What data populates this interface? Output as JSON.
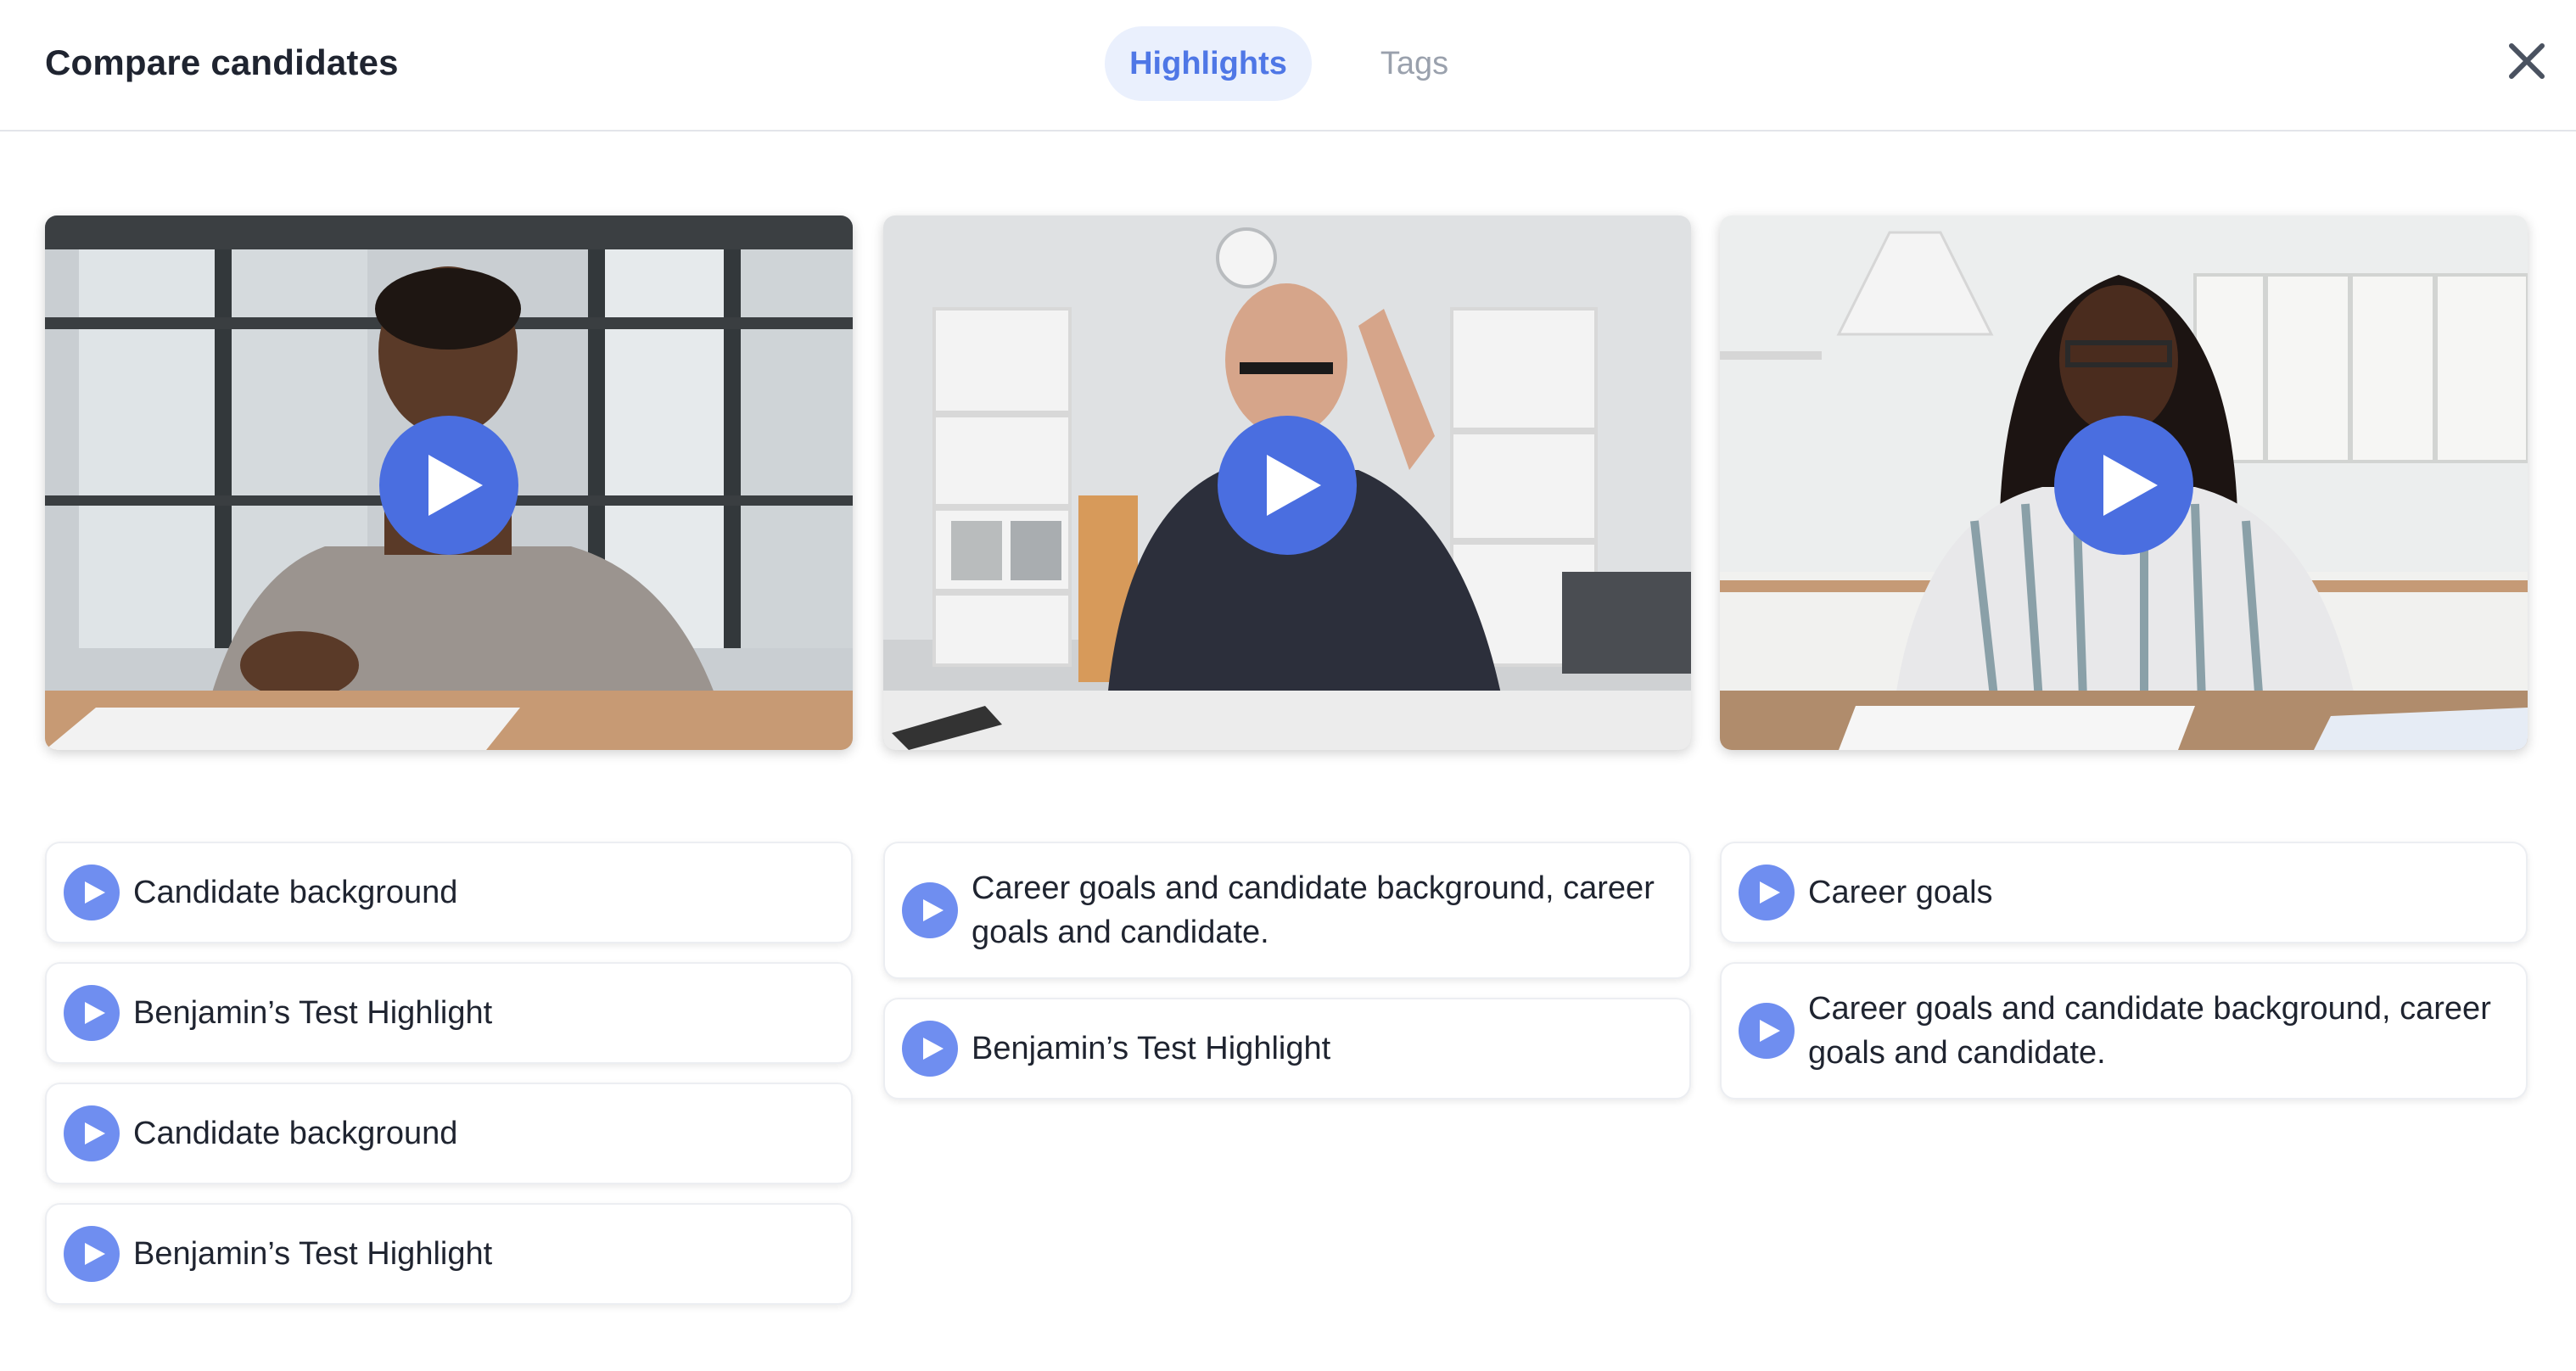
{
  "header": {
    "title": "Compare candidates",
    "tabs": [
      {
        "label": "Highlights",
        "active": true
      },
      {
        "label": "Tags",
        "active": false
      }
    ],
    "close_icon": "close-icon"
  },
  "colors": {
    "accent": "#4f77e6",
    "active_tab_bg": "#eaf0fd",
    "inactive_tab": "#9aa1ad",
    "play_button": "#4a6ee0",
    "chip_play": "#6f8ef0"
  },
  "candidates": [
    {
      "video_icon": "play-icon",
      "highlights": [
        {
          "label": "Candidate background"
        },
        {
          "label": "Benjamin’s Test Highlight"
        },
        {
          "label": "Candidate background"
        },
        {
          "label": "Benjamin’s Test Highlight"
        }
      ]
    },
    {
      "video_icon": "play-icon",
      "highlights": [
        {
          "label": "Career goals and candidate background, career goals and candidate."
        },
        {
          "label": "Benjamin’s Test Highlight"
        }
      ]
    },
    {
      "video_icon": "play-icon",
      "highlights": [
        {
          "label": "Career goals"
        },
        {
          "label": "Career goals and candidate background, career goals and candidate."
        }
      ]
    }
  ]
}
